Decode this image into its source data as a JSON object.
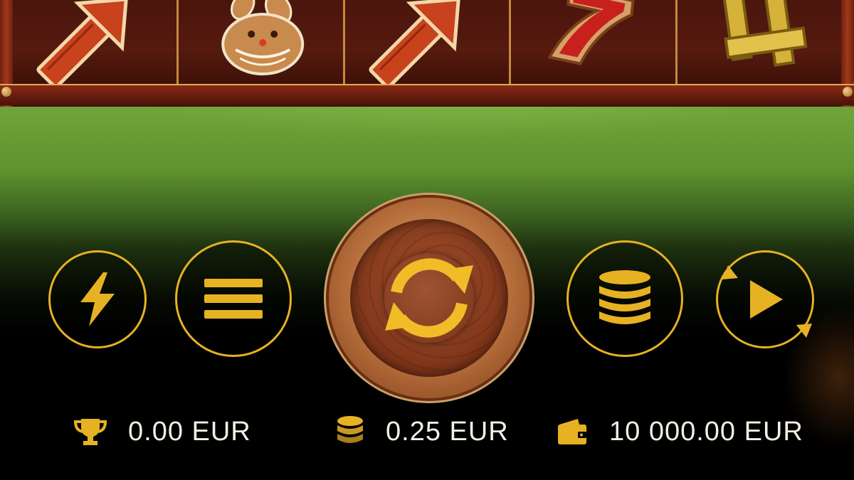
{
  "colors": {
    "accent_gold": "#e6b224",
    "text": "#f3efe4",
    "reel_bg": "#4a150c",
    "felt_green": "#6ea33a"
  },
  "reels": [
    {
      "symbol": "arrow-up-left-icon"
    },
    {
      "symbol": "gingerbread-man-icon"
    },
    {
      "symbol": "arrow-up-left-icon"
    },
    {
      "symbol": "seven-icon"
    },
    {
      "symbol": "number-4-icon"
    }
  ],
  "controls": {
    "turbo": {
      "icon": "lightning-icon"
    },
    "menu": {
      "icon": "hamburger-menu-icon"
    },
    "spin": {
      "icon": "spin-arrows-icon"
    },
    "bet": {
      "icon": "coin-stack-icon"
    },
    "autoplay": {
      "icon": "play-icon"
    }
  },
  "info_bar": {
    "win": {
      "icon": "trophy-icon",
      "value": "0.00 EUR"
    },
    "bet": {
      "icon": "coins-icon",
      "value": "0.25 EUR"
    },
    "balance": {
      "icon": "wallet-icon",
      "value": "10 000.00 EUR"
    }
  }
}
